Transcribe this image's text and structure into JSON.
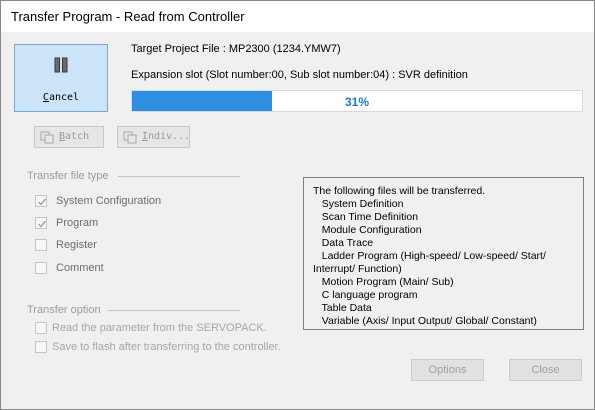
{
  "window": {
    "title": "Transfer Program - Read from Controller"
  },
  "cancel_button": {
    "label_underlined": "C",
    "label_rest": "ancel",
    "icon": "pause-icon"
  },
  "info": {
    "target_project": "Target Project File : MP2300      (1234.YMW7)",
    "expansion_slot": "Expansion slot  (Slot number:00, Sub slot number:04) : SVR definition"
  },
  "progress": {
    "percent": 31,
    "text": "31%"
  },
  "toolbar": {
    "batch": {
      "label_underlined": "B",
      "label_rest": "atch",
      "icon": "batch-icon"
    },
    "indiv": {
      "label_underlined": "I",
      "label_rest": "ndiv...",
      "icon": "individual-icon"
    }
  },
  "transfer_file_type": {
    "label": "Transfer file type",
    "items": [
      {
        "label": "System Configuration",
        "checked": true
      },
      {
        "label": "Program",
        "checked": true
      },
      {
        "label": "Register",
        "checked": false
      },
      {
        "label": "Comment",
        "checked": false
      }
    ]
  },
  "transfer_option": {
    "label": "Transfer option",
    "items": [
      {
        "label": "Read the parameter from the SERVOPACK.",
        "checked": false
      },
      {
        "label": "Save to flash after transferring to the controller.",
        "checked": false
      }
    ]
  },
  "files_box": {
    "lines": [
      "The following files will be transferred.",
      "   System Definition",
      "   Scan Time Definition",
      "   Module Configuration",
      "   Data Trace",
      "   Ladder Program (High-speed/ Low-speed/ Start/",
      "Interrupt/ Function)",
      "   Motion Program (Main/ Sub)",
      "   C language program",
      "   Table Data",
      "   Variable (Axis/ Input Output/ Global/ Constant)"
    ]
  },
  "buttons": {
    "options": "Options",
    "close": "Close"
  }
}
